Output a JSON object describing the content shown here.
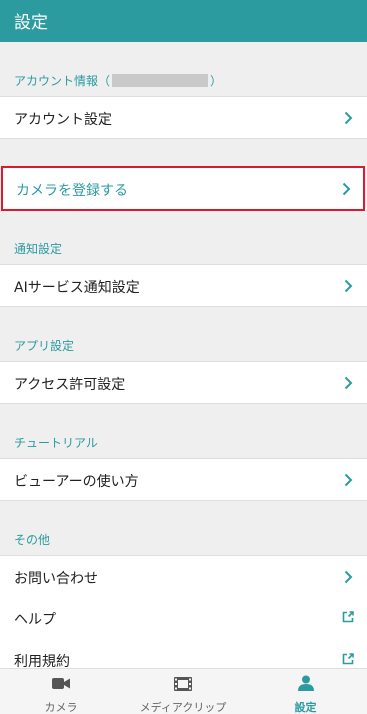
{
  "header": {
    "title": "設定"
  },
  "sections": {
    "account": {
      "label_prefix": "アカウント情報（",
      "label_suffix": "）"
    },
    "notification": {
      "label": "通知設定"
    },
    "app": {
      "label": "アプリ設定"
    },
    "tutorial": {
      "label": "チュートリアル"
    },
    "other": {
      "label": "その他"
    }
  },
  "rows": {
    "account_settings": "アカウント設定",
    "register_camera": "カメラを登録する",
    "ai_notification": "AIサービス通知設定",
    "access_permission": "アクセス許可設定",
    "viewer_howto": "ビューアーの使い方",
    "contact": "お問い合わせ",
    "help": "ヘルプ",
    "terms": "利用規約"
  },
  "tabbar": {
    "camera": "カメラ",
    "media_clip": "メディアクリップ",
    "settings": "設定"
  },
  "colors": {
    "accent": "#2b9ba0",
    "highlight_border": "#e0182d"
  }
}
